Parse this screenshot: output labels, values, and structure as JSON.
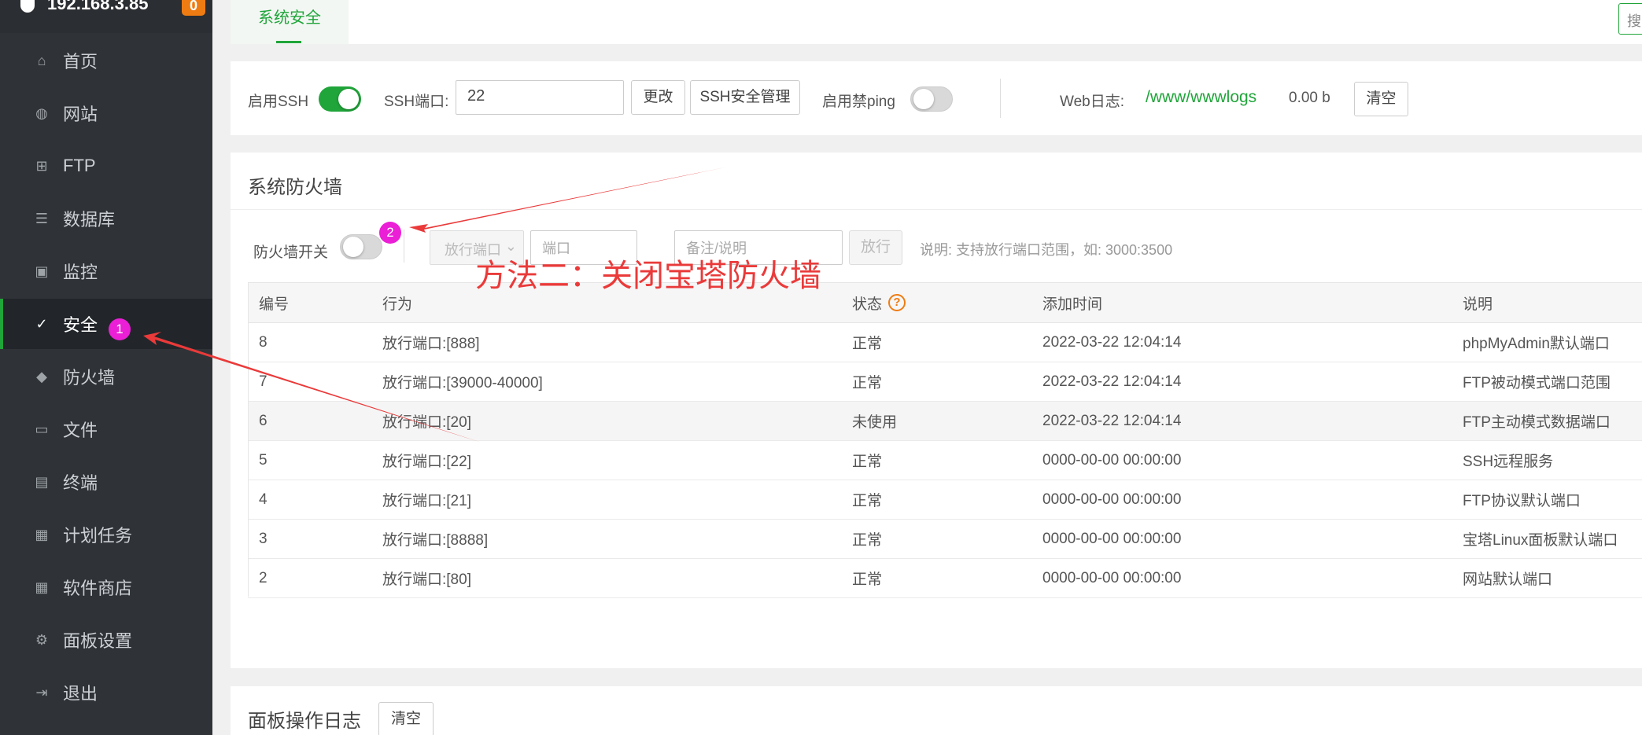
{
  "sidebar": {
    "host": "192.168.3.85",
    "host_badge": "0",
    "items": [
      {
        "label": "首页",
        "icon": "home-icon"
      },
      {
        "label": "网站",
        "icon": "globe-icon"
      },
      {
        "label": "FTP",
        "icon": "ftp-icon"
      },
      {
        "label": "数据库",
        "icon": "database-icon"
      },
      {
        "label": "监控",
        "icon": "monitor-icon"
      },
      {
        "label": "安全",
        "icon": "shield-check-icon",
        "active": true
      },
      {
        "label": "防火墙",
        "icon": "shield-icon"
      },
      {
        "label": "文件",
        "icon": "folder-icon"
      },
      {
        "label": "终端",
        "icon": "terminal-icon"
      },
      {
        "label": "计划任务",
        "icon": "calendar-icon"
      },
      {
        "label": "软件商店",
        "icon": "apps-icon"
      },
      {
        "label": "面板设置",
        "icon": "gear-icon"
      },
      {
        "label": "退出",
        "icon": "logout-icon"
      }
    ]
  },
  "tabs": {
    "active": "系统安全",
    "search_stub": "搜"
  },
  "ssh_bar": {
    "ssh_label": "启用SSH",
    "ssh_enabled": true,
    "port_label": "SSH端口:",
    "port_value": "22",
    "change_btn": "更改",
    "ssh_manage_btn": "SSH安全管理",
    "ping_label": "启用禁ping",
    "ping_enabled": false,
    "weblog_label": "Web日志:",
    "weblog_path": "/www/wwwlogs",
    "weblog_size": "0.00 b",
    "clear_btn": "清空"
  },
  "firewall": {
    "title": "系统防火墙",
    "switch_label": "防火墙开关",
    "switch_enabled": false,
    "mode_select": "放行端口",
    "port_placeholder": "端口",
    "note_placeholder": "备注/说明",
    "allow_btn": "放行",
    "hint": "说明: 支持放行端口范围，如: 3000:3500",
    "columns": [
      "编号",
      "行为",
      "状态",
      "添加时间",
      "说明"
    ],
    "rows": [
      {
        "id": "8",
        "action": "放行端口:[888]",
        "status": "正常",
        "time": "2022-03-22 12:04:14",
        "note": "phpMyAdmin默认端口"
      },
      {
        "id": "7",
        "action": "放行端口:[39000-40000]",
        "status": "正常",
        "time": "2022-03-22 12:04:14",
        "note": "FTP被动模式端口范围"
      },
      {
        "id": "6",
        "action": "放行端口:[20]",
        "status": "未使用",
        "time": "2022-03-22 12:04:14",
        "note": "FTP主动模式数据端口"
      },
      {
        "id": "5",
        "action": "放行端口:[22]",
        "status": "正常",
        "time": "0000-00-00 00:00:00",
        "note": "SSH远程服务"
      },
      {
        "id": "4",
        "action": "放行端口:[21]",
        "status": "正常",
        "time": "0000-00-00 00:00:00",
        "note": "FTP协议默认端口"
      },
      {
        "id": "3",
        "action": "放行端口:[8888]",
        "status": "正常",
        "time": "0000-00-00 00:00:00",
        "note": "宝塔Linux面板默认端口"
      },
      {
        "id": "2",
        "action": "放行端口:[80]",
        "status": "正常",
        "time": "0000-00-00 00:00:00",
        "note": "网站默认端口"
      }
    ]
  },
  "panel_log": {
    "title": "面板操作日志",
    "clear_btn": "清空"
  },
  "annotations": {
    "text": "方法二：关闭宝塔防火墙",
    "badge1": "1",
    "badge2": "2",
    "color": "#ea3a3a",
    "badge_color": "#ea1fd6"
  }
}
